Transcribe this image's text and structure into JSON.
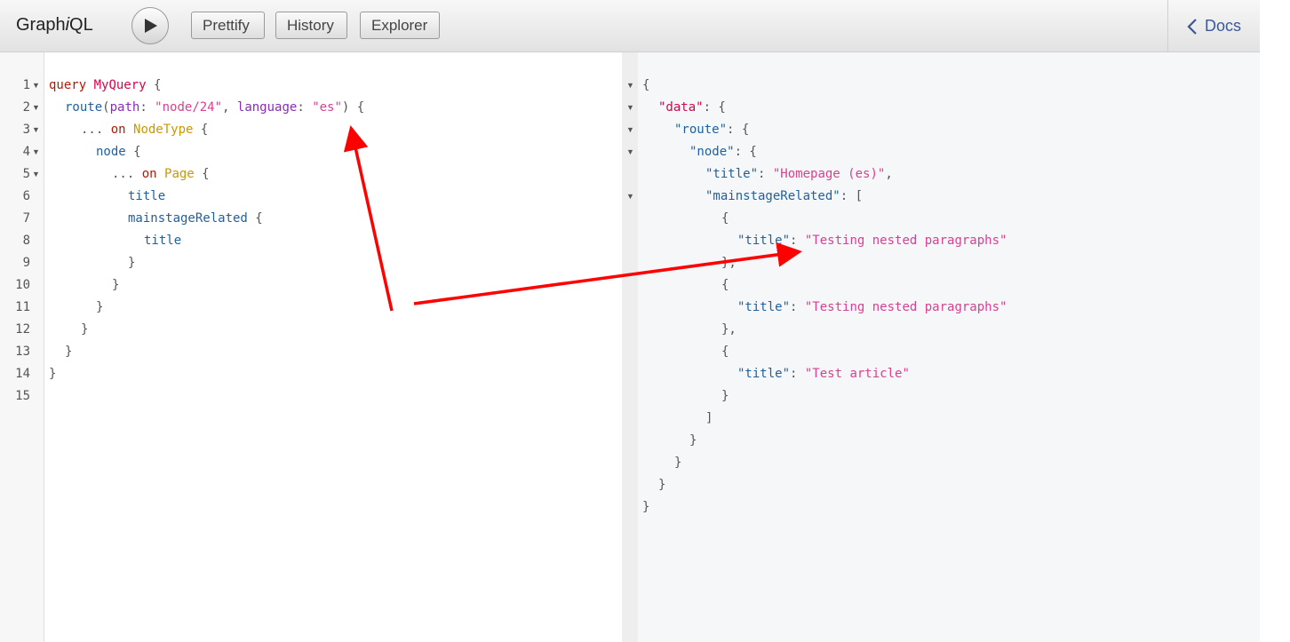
{
  "toolbar": {
    "logo_prefix": "Graph",
    "logo_italic": "i",
    "logo_suffix": "QL",
    "prettify_label": "Prettify",
    "history_label": "History",
    "explorer_label": "Explorer",
    "docs_label": "Docs"
  },
  "icons": {
    "run": "play-icon",
    "docs": "chevron-left-icon",
    "fold": "fold-triangle-icon"
  },
  "colors": {
    "keyword": "#b11a04",
    "definition": "#d2054e",
    "field": "#1f61a0",
    "argument": "#8b2bb9",
    "string": "#d64292",
    "type": "#ca9800",
    "annotation_arrow": "#ff0000"
  },
  "editor": {
    "line_numbers": [
      "1",
      "2",
      "3",
      "4",
      "5",
      "6",
      "7",
      "8",
      "9",
      "10",
      "11",
      "12",
      "13",
      "14",
      "15"
    ],
    "tokens": {
      "l1_kw": "query",
      "l1_name": "MyQuery",
      "l1_brace": "{",
      "l2_field": "route",
      "l2_open": "(",
      "l2_arg1": "path",
      "l2_colon1": ": ",
      "l2_str1": "\"node/24\"",
      "l2_comma": ", ",
      "l2_arg2": "language",
      "l2_colon2": ": ",
      "l2_str2": "\"es\"",
      "l2_close": ") {",
      "l3_spread": "... ",
      "l3_on": "on",
      "l3_type": "NodeType",
      "l3_brace": " {",
      "l4_field": "node",
      "l4_brace": " {",
      "l5_spread": "... ",
      "l5_on": "on",
      "l5_type": "Page",
      "l5_brace": " {",
      "l6_field": "title",
      "l7_field": "mainstageRelated",
      "l7_brace": " {",
      "l8_field": "title",
      "l9": "}",
      "l10": "}",
      "l11": "}",
      "l12": "}",
      "l13": "}",
      "l14": "}"
    }
  },
  "result": {
    "r1": "{",
    "r2_key": "\"data\"",
    "r2_rest": ": {",
    "r3_key": "\"route\"",
    "r3_rest": ": {",
    "r4_key": "\"node\"",
    "r4_rest": ": {",
    "r5_key": "\"title\"",
    "r5_colon": ": ",
    "r5_val": "\"Homepage (es)\"",
    "r5_comma": ",",
    "r6_key": "\"mainstageRelated\"",
    "r6_rest": ": [",
    "r7": "{",
    "r8_key": "\"title\"",
    "r8_colon": ": ",
    "r8_val": "\"Testing nested paragraphs\"",
    "r9": "},",
    "r10": "{",
    "r11_key": "\"title\"",
    "r11_colon": ": ",
    "r11_val": "\"Testing nested paragraphs\"",
    "r12": "},",
    "r13": "{",
    "r14_key": "\"title\"",
    "r14_colon": ": ",
    "r14_val": "\"Test article\"",
    "r15": "}",
    "r16": "]",
    "r17": "}",
    "r18": "}",
    "r19": "}",
    "r20": "}"
  }
}
